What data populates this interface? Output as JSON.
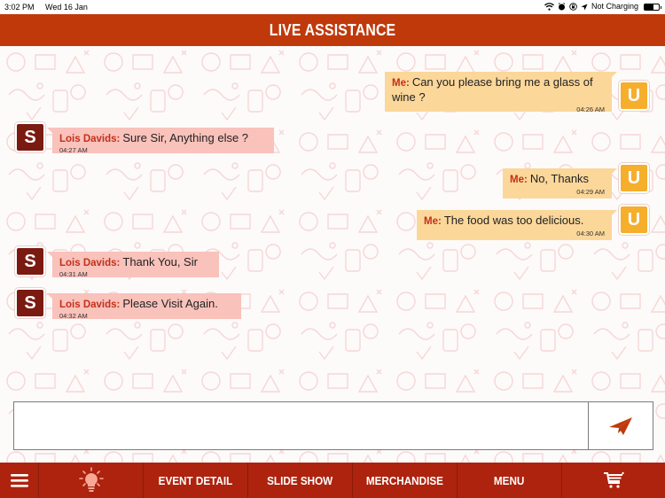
{
  "status_bar": {
    "time": "3:02 PM",
    "date": "Wed 16 Jan",
    "icons": [
      "wifi-icon",
      "alarm-icon",
      "rotation-lock-icon",
      "location-icon"
    ],
    "charging_text": "Not Charging",
    "battery_level": 0.6
  },
  "header": {
    "title": "LIVE ASSISTANCE",
    "color": "#c0390b"
  },
  "messages": [
    {
      "from": "me",
      "avatar": "U",
      "sender": "Me:",
      "text": "Can you please bring me a glass of wine ?",
      "time": "04:26 AM"
    },
    {
      "from": "staff",
      "avatar": "S",
      "sender": "Lois Davids:",
      "text": "Sure Sir, Anything else ?",
      "time": "04:27 AM"
    },
    {
      "from": "me",
      "avatar": "U",
      "sender": "Me:",
      "text": "No, Thanks",
      "time": "04:29 AM"
    },
    {
      "from": "me",
      "avatar": "U",
      "sender": "Me:",
      "text": "The food was too delicious.",
      "time": "04:30 AM"
    },
    {
      "from": "staff",
      "avatar": "S",
      "sender": "Lois Davids:",
      "text": "Thank You, Sir",
      "time": "04:31 AM"
    },
    {
      "from": "staff",
      "avatar": "S",
      "sender": "Lois Davids:",
      "text": "Please Visit Again.",
      "time": "04:32 AM"
    }
  ],
  "composer": {
    "value": "",
    "placeholder": "",
    "send_icon": "paper-plane-icon"
  },
  "bottom_nav": {
    "items": [
      {
        "id": "menu-toggle",
        "icon": "hamburger-icon",
        "label": ""
      },
      {
        "id": "tips",
        "icon": "lightbulb-icon",
        "label": ""
      },
      {
        "id": "event-detail",
        "icon": "",
        "label": "EVENT DETAIL"
      },
      {
        "id": "slide-show",
        "icon": "",
        "label": "SLIDE SHOW"
      },
      {
        "id": "merchandise",
        "icon": "",
        "label": "MERCHANDISE"
      },
      {
        "id": "menu",
        "icon": "",
        "label": "MENU"
      },
      {
        "id": "cart",
        "icon": "cart-icon",
        "label": ""
      }
    ]
  },
  "colors": {
    "brand": "#c0390b",
    "nav": "#ad230e",
    "me_bubble": "#fbd79a",
    "staff_bubble": "#f9c2bb",
    "user_avatar": "#f6ae2d",
    "staff_avatar": "#7b1a10",
    "sender_name": "#c3301a"
  }
}
